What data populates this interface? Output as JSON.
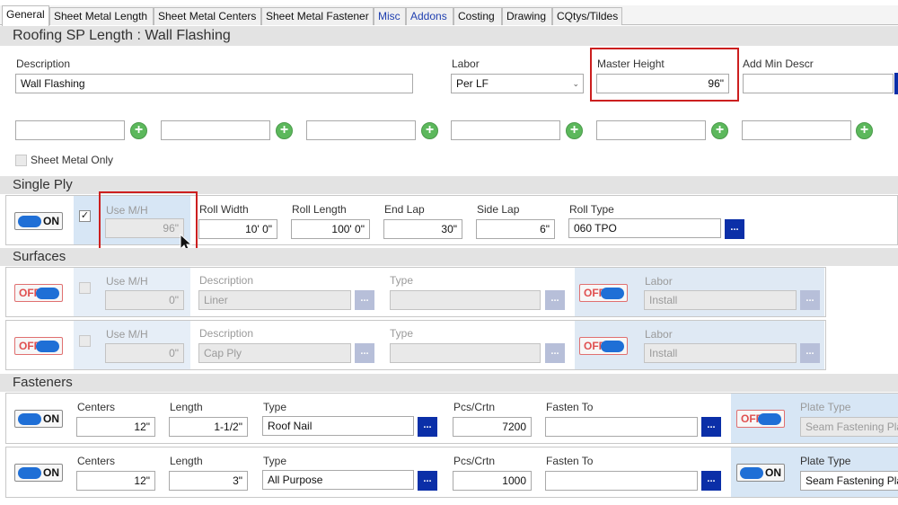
{
  "tabs": [
    {
      "label": "General",
      "active": true
    },
    {
      "label": "Sheet Metal Length"
    },
    {
      "label": "Sheet Metal Centers"
    },
    {
      "label": "Sheet Metal Fastener"
    },
    {
      "label": "Misc",
      "blue": true
    },
    {
      "label": "Addons",
      "blue": true
    },
    {
      "label": "Costing"
    },
    {
      "label": "Drawing"
    },
    {
      "label": "CQtys/Tildes"
    }
  ],
  "page_title": "Roofing SP Length : Wall Flashing",
  "general": {
    "description_label": "Description",
    "description_value": "Wall Flashing",
    "labor_label": "Labor",
    "labor_value": "Per LF",
    "master_height_label": "Master Height",
    "master_height_value": "96\"",
    "add_min_descr_label": "Add Min Descr",
    "sheet_metal_only_label": "Sheet Metal Only"
  },
  "single_ply": {
    "title": "Single Ply",
    "toggle": "ON",
    "use_mh_label": "Use M/H",
    "use_mh_value": "96\"",
    "use_mh_checked": "✓",
    "roll_width_label": "Roll Width",
    "roll_width_value": "10' 0\"",
    "roll_length_label": "Roll Length",
    "roll_length_value": "100' 0\"",
    "end_lap_label": "End Lap",
    "end_lap_value": "30\"",
    "side_lap_label": "Side Lap",
    "side_lap_value": "6\"",
    "roll_type_label": "Roll Type",
    "roll_type_value": "060 TPO",
    "dots": "..."
  },
  "surfaces": {
    "title": "Surfaces",
    "rows": [
      {
        "toggle": "OFF",
        "use_mh_label": "Use M/H",
        "use_mh_value": "0\"",
        "description_label": "Description",
        "description_value": "Liner",
        "type_label": "Type",
        "labor_toggle": "OFF",
        "labor_label": "Labor",
        "labor_value": "Install",
        "dots": "..."
      },
      {
        "toggle": "OFF",
        "use_mh_label": "Use M/H",
        "use_mh_value": "0\"",
        "description_label": "Description",
        "description_value": "Cap Ply",
        "type_label": "Type",
        "labor_toggle": "OFF",
        "labor_label": "Labor",
        "labor_value": "Install",
        "dots": "..."
      }
    ]
  },
  "fasteners": {
    "title": "Fasteners",
    "rows": [
      {
        "toggle": "ON",
        "centers_label": "Centers",
        "centers_value": "12\"",
        "length_label": "Length",
        "length_value": "1-1/2\"",
        "type_label": "Type",
        "type_value": "Roof Nail",
        "pcs_label": "Pcs/Crtn",
        "pcs_value": "7200",
        "fasten_to_label": "Fasten To",
        "plate_toggle": "OFF",
        "plate_type_label": "Plate Type",
        "plate_type_value": "Seam Fastening Pla",
        "dots": "..."
      },
      {
        "toggle": "ON",
        "centers_label": "Centers",
        "centers_value": "12\"",
        "length_label": "Length",
        "length_value": "3\"",
        "type_label": "Type",
        "type_value": "All Purpose",
        "pcs_label": "Pcs/Crtn",
        "pcs_value": "1000",
        "fasten_to_label": "Fasten To",
        "plate_toggle": "ON",
        "plate_type_label": "Plate Type",
        "plate_type_value": "Seam Fastening Pla",
        "dots": "..."
      }
    ]
  },
  "colors": {
    "accent": "#1f6fd6",
    "highlight": "#cc1f1f",
    "plus": "#5cb85c",
    "button": "#0b2fa8"
  }
}
